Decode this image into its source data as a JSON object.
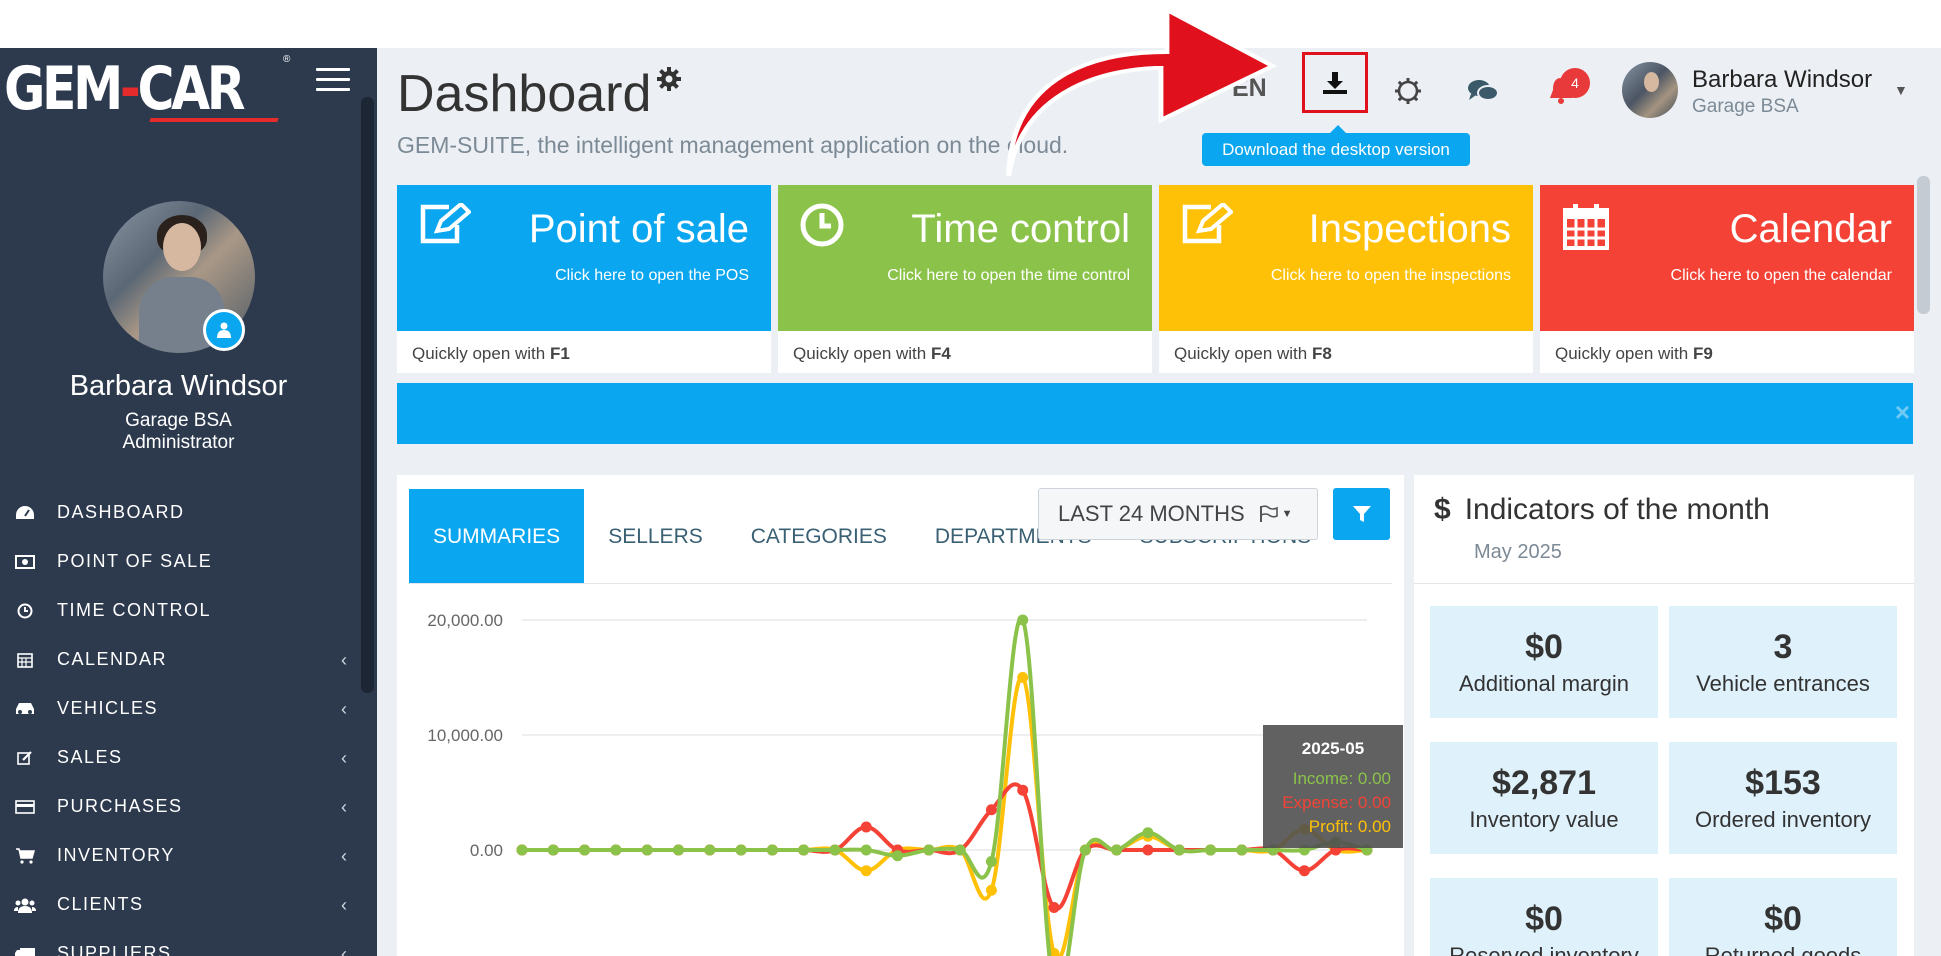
{
  "brand": {
    "logo_left": "GEM",
    "logo_dash": "-",
    "logo_right": "CAR",
    "logo_reg": "®"
  },
  "user": {
    "name": "Barbara Windsor",
    "company": "Garage BSA",
    "role": "Administrator"
  },
  "sidebar": {
    "items": [
      {
        "label": "DASHBOARD",
        "icon": "dashboard-icon",
        "has_chevron": false
      },
      {
        "label": "POINT OF SALE",
        "icon": "money-icon",
        "has_chevron": false
      },
      {
        "label": "TIME CONTROL",
        "icon": "clock-icon",
        "has_chevron": false
      },
      {
        "label": "CALENDAR",
        "icon": "calendar-icon",
        "has_chevron": true
      },
      {
        "label": "VEHICLES",
        "icon": "car-icon",
        "has_chevron": true
      },
      {
        "label": "SALES",
        "icon": "edit-icon",
        "has_chevron": true
      },
      {
        "label": "PURCHASES",
        "icon": "credit-card-icon",
        "has_chevron": true
      },
      {
        "label": "INVENTORY",
        "icon": "cart-icon",
        "has_chevron": true
      },
      {
        "label": "CLIENTS",
        "icon": "users-icon",
        "has_chevron": true
      },
      {
        "label": "SUPPLIERS",
        "icon": "truck-icon",
        "has_chevron": true
      }
    ],
    "chevron": "‹"
  },
  "header": {
    "title": "Dashboard",
    "subtitle": "GEM-SUITE, the intelligent management application on the cloud.",
    "language": "EN",
    "download_tooltip": "Download the desktop version",
    "notification_count": "4",
    "user_name": "Barbara Windsor",
    "user_company": "Garage BSA"
  },
  "tiles": [
    {
      "title": "Point of sale",
      "subtitle": "Click here to open the POS",
      "shortcut_prefix": "Quickly open with ",
      "shortcut_key": "F1",
      "color": "#0ba6f0",
      "icon": "edit-icon"
    },
    {
      "title": "Time control",
      "subtitle": "Click here to open the time control",
      "shortcut_prefix": "Quickly open with ",
      "shortcut_key": "F4",
      "color": "#8bc34a",
      "icon": "clock-icon"
    },
    {
      "title": "Inspections",
      "subtitle": "Click here to open the inspections",
      "shortcut_prefix": "Quickly open with ",
      "shortcut_key": "F8",
      "color": "#ffc107",
      "icon": "edit-icon"
    },
    {
      "title": "Calendar",
      "subtitle": "Click here to open the calendar",
      "shortcut_prefix": "Quickly open with ",
      "shortcut_key": "F9",
      "color": "#f44336",
      "icon": "calendar-icon"
    }
  ],
  "banner": {
    "close": "×"
  },
  "summary_card": {
    "tabs": [
      "SUMMARIES",
      "SELLERS",
      "CATEGORIES",
      "DEPARTMENTS",
      "SUBSCRIPTIONS"
    ],
    "range_label": "LAST 24 MONTHS",
    "tooltip": {
      "date": "2025-05",
      "income": "Income: 0.00",
      "expense": "Expense: 0.00",
      "profit": "Profit: 0.00"
    }
  },
  "chart_data": {
    "type": "line",
    "title": "",
    "xlabel": "",
    "ylabel": "",
    "ylim": [
      -10000,
      20000
    ],
    "y_ticks": [
      "20,000.00",
      "10,000.00",
      "0.00"
    ],
    "grid": true,
    "series": [
      {
        "name": "Income",
        "color": "#8bc34a",
        "values": [
          0,
          0,
          0,
          0,
          0,
          0,
          0,
          0,
          0,
          0,
          0,
          0,
          -500,
          0,
          0,
          -1000,
          20000,
          -12000,
          0,
          0,
          1500,
          0,
          0,
          0,
          0,
          0,
          700,
          0
        ]
      },
      {
        "name": "Expense",
        "color": "#f44336",
        "values": [
          0,
          0,
          0,
          0,
          0,
          0,
          0,
          0,
          0,
          0,
          0,
          2000,
          0,
          0,
          0,
          3500,
          5200,
          -5000,
          0,
          0,
          0,
          0,
          0,
          0,
          0,
          -1800,
          0,
          0
        ]
      },
      {
        "name": "Profit",
        "color": "#ffc107",
        "values": [
          0,
          0,
          0,
          0,
          0,
          0,
          0,
          0,
          0,
          0,
          0,
          -1800,
          0,
          0,
          0,
          -3500,
          15000,
          -9000,
          0,
          0,
          1200,
          0,
          0,
          0,
          0,
          1800,
          0,
          0
        ]
      }
    ]
  },
  "indicators": {
    "title": "Indicators of the month",
    "currency_symbol": "$",
    "date": "May 2025",
    "items": [
      {
        "value": "$0",
        "label": "Additional margin"
      },
      {
        "value": "3",
        "label": "Vehicle entrances"
      },
      {
        "value": "$2,871",
        "label": "Inventory value"
      },
      {
        "value": "$153",
        "label": "Ordered inventory"
      },
      {
        "value": "$0",
        "label": "Reserved inventory"
      },
      {
        "value": "$0",
        "label": "Returned goods"
      }
    ]
  }
}
